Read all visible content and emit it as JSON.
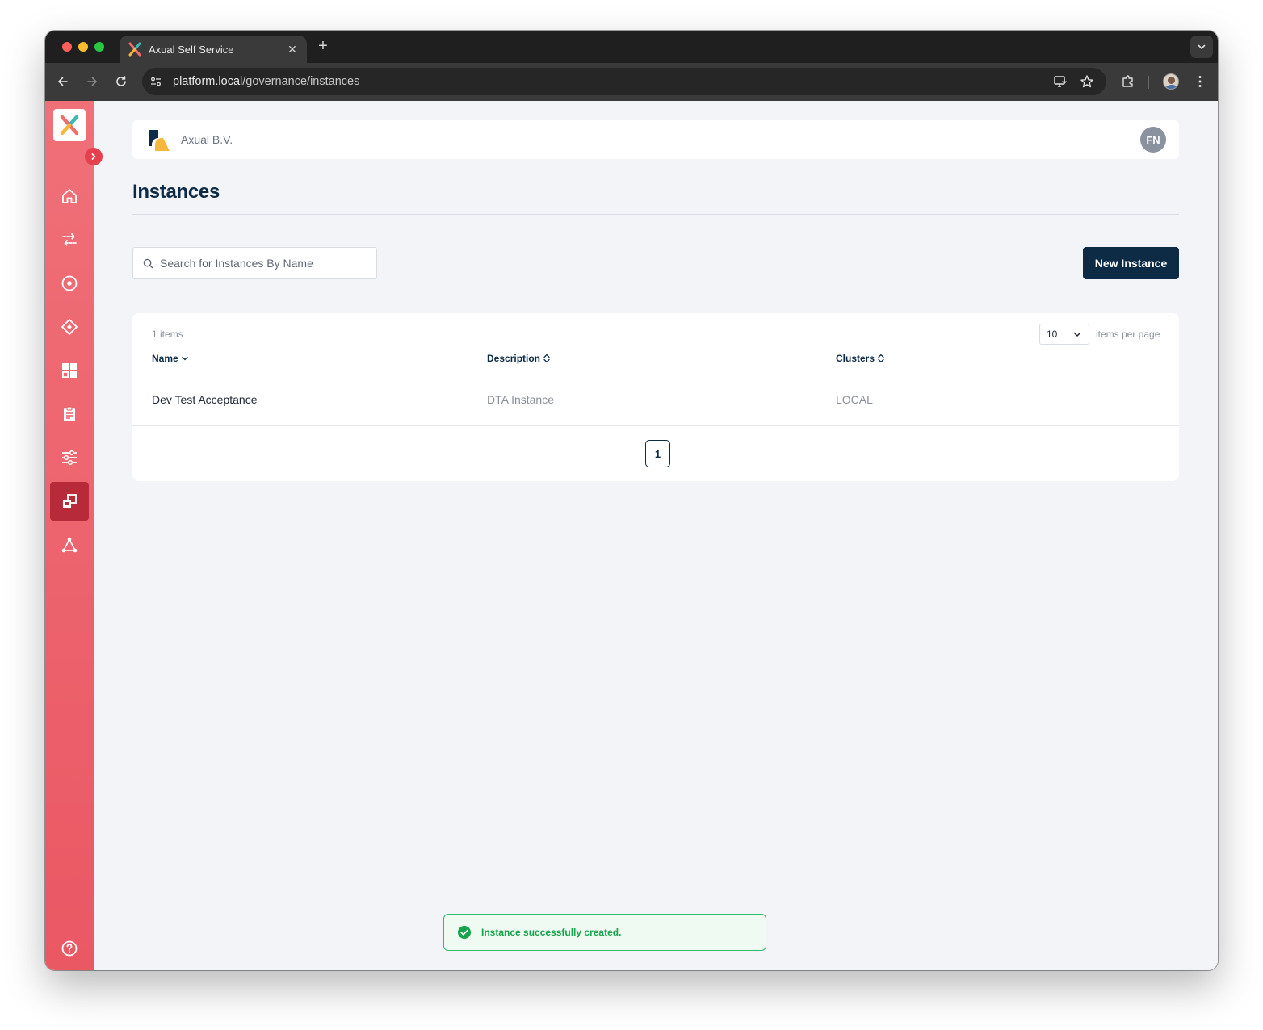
{
  "browser": {
    "tab_title": "Axual Self Service",
    "tab_close": "✕",
    "new_tab": "+",
    "url_host": "platform.local",
    "url_path": "/governance/instances"
  },
  "sidebar": {
    "items": [
      {
        "name": "home",
        "icon": "home-icon"
      },
      {
        "name": "streams",
        "icon": "streams-icon"
      },
      {
        "name": "applications",
        "icon": "target-icon"
      },
      {
        "name": "schemas",
        "icon": "diamond-icon"
      },
      {
        "name": "dashboard",
        "icon": "grid-icon"
      },
      {
        "name": "reports",
        "icon": "clipboard-icon"
      },
      {
        "name": "settings",
        "icon": "sliders-icon"
      },
      {
        "name": "instances",
        "icon": "instances-icon",
        "active": true
      },
      {
        "name": "clusters",
        "icon": "network-icon"
      }
    ],
    "help_icon": "help-icon"
  },
  "header": {
    "org_name": "Axual B.V.",
    "user_initials": "FN"
  },
  "page": {
    "title": "Instances",
    "search_placeholder": "Search for Instances By Name",
    "new_button": "New Instance"
  },
  "table": {
    "items_count": "1 items",
    "per_page_value": "10",
    "per_page_label": "items per page",
    "columns": {
      "name": "Name",
      "description": "Description",
      "clusters": "Clusters"
    },
    "rows": [
      {
        "name": "Dev Test Acceptance",
        "description": "DTA Instance",
        "clusters": "LOCAL"
      }
    ],
    "current_page": "1"
  },
  "toast": {
    "message": "Instance successfully created.",
    "color": "#17a34a"
  },
  "colors": {
    "sidebar": "#ea5864",
    "sidebar_active": "#b62a3a",
    "primary": "#0d2b45"
  }
}
